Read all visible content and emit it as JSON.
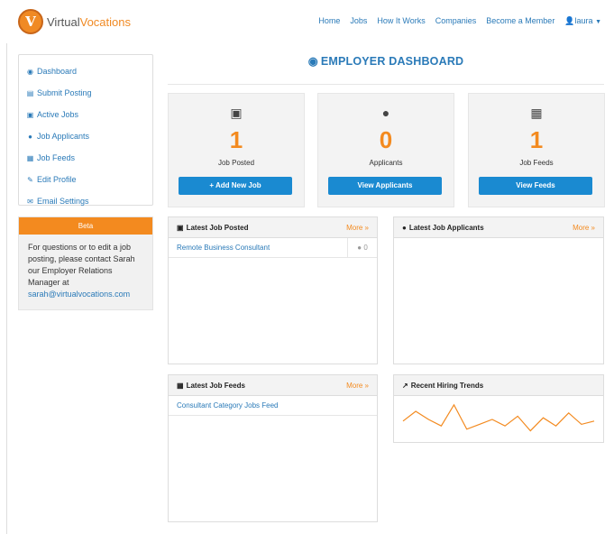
{
  "brand": {
    "part1": "Virtual",
    "part2": "Vocations",
    "mark": "V"
  },
  "nav": {
    "items": [
      "Home",
      "Jobs",
      "How It Works",
      "Companies",
      "Become a Member"
    ],
    "user": "laura"
  },
  "sidebar": {
    "items": [
      {
        "label": "Dashboard",
        "icon": "dashboard-icon"
      },
      {
        "label": "Submit Posting",
        "icon": "list-icon"
      },
      {
        "label": "Active Jobs",
        "icon": "briefcase-icon"
      },
      {
        "label": "Job Applicants",
        "icon": "user-icon"
      },
      {
        "label": "Job Feeds",
        "icon": "file-icon"
      },
      {
        "label": "Edit Profile",
        "icon": "edit-icon"
      },
      {
        "label": "Email Settings",
        "icon": "envelope-icon"
      }
    ],
    "beta": {
      "title": "Beta",
      "text": "For questions or to edit a job posting, please contact Sarah our Employer Relations Manager at",
      "email": "sarah@virtualvocations.com"
    }
  },
  "dashboard": {
    "title": "EMPLOYER DASHBOARD",
    "stats": [
      {
        "number": "1",
        "label": "Job Posted",
        "button": "+ Add New Job",
        "icon": "briefcase-icon"
      },
      {
        "number": "0",
        "label": "Applicants",
        "button": "View Applicants",
        "icon": "user-icon"
      },
      {
        "number": "1",
        "label": "Job Feeds",
        "button": "View Feeds",
        "icon": "file-icon"
      }
    ],
    "panels": {
      "latest_jobs": {
        "title": "Latest Job Posted",
        "more": "More »",
        "rows": [
          {
            "title": "Remote Business Consultant",
            "count": "0"
          }
        ]
      },
      "latest_applicants": {
        "title": "Latest Job Applicants",
        "more": "More »"
      },
      "latest_feeds": {
        "title": "Latest Job Feeds",
        "more": "More »",
        "rows": [
          {
            "title": "Consultant Category Jobs Feed"
          }
        ]
      },
      "hiring_trends": {
        "title": "Recent Hiring Trends",
        "series": [
          0.45,
          0.75,
          0.5,
          0.3,
          0.95,
          0.2,
          0.35,
          0.5,
          0.3,
          0.6,
          0.15,
          0.55,
          0.3,
          0.7,
          0.35,
          0.45
        ]
      }
    }
  },
  "colors": {
    "accent": "#f38a1f",
    "link": "#2a7ab8",
    "button": "#1a8ad1"
  }
}
